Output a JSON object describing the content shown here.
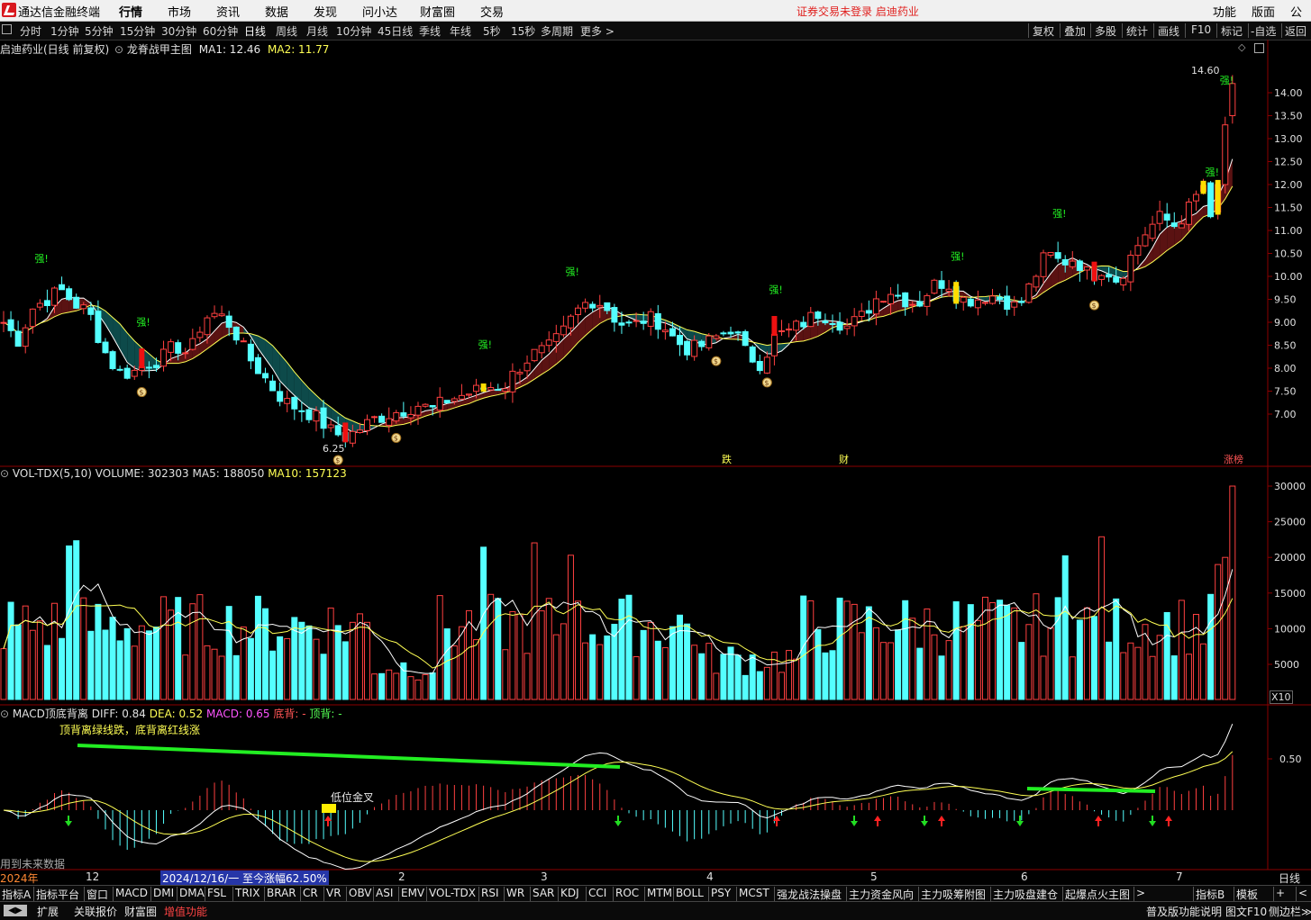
{
  "app": {
    "title": "通达信金融终端",
    "menus": [
      "行情",
      "市场",
      "资讯",
      "数据",
      "发现",
      "问小达",
      "财富圈",
      "交易"
    ],
    "notice": "证券交易未登录  启迪药业",
    "right_menus": [
      "功能",
      "版面",
      "公式"
    ]
  },
  "toolbar": {
    "periods": [
      "分时",
      "1分钟",
      "5分钟",
      "15分钟",
      "30分钟",
      "60分钟",
      "日线",
      "周线",
      "月线",
      "10分钟",
      "45日线",
      "季线",
      "年线",
      "5秒",
      "15秒",
      "多周期",
      "更多 >"
    ],
    "active": "日线",
    "right_buttons": [
      "复权",
      "叠加",
      "多股",
      "统计",
      "画线",
      "F10",
      "标记",
      "-自选",
      "返回"
    ]
  },
  "main_panel": {
    "stock": "启迪药业(日线 前复权)",
    "indicator": "龙脊战甲主图",
    "ma1": "MA1: 12.46",
    "ma2": "MA2: 11.77",
    "high_label": "14.60",
    "low_label": "6.25",
    "strong_label": "强!",
    "markers": [
      "跌",
      "财",
      "涨榜"
    ],
    "y_ticks": [
      "14.00",
      "13.50",
      "13.00",
      "12.50",
      "12.00",
      "11.50",
      "11.00",
      "10.50",
      "10.00",
      "9.50",
      "9.00",
      "8.50",
      "8.00",
      "7.50",
      "7.00"
    ]
  },
  "volume_panel": {
    "title": "VOL-TDX(5,10)",
    "volume": "VOLUME: 302303",
    "ma5": "MA5: 188050",
    "ma10": "MA10: 157123",
    "y_ticks": [
      "30000",
      "25000",
      "20000",
      "15000",
      "10000",
      "5000"
    ],
    "unit": "X10"
  },
  "macd_panel": {
    "title": "MACD顶底背离",
    "diff": "DIFF: 0.84",
    "dea": "DEA: 0.52",
    "macd": "MACD: 0.65",
    "bottom_div": "底背: -",
    "top_div": "顶背: -",
    "legend_text": "顶背离绿线跌，底背离红线涨",
    "golden_cross": "低位金叉",
    "future_text": "用到未来数据",
    "y_tick": "0.50"
  },
  "date_axis": {
    "labels": [
      "2024年",
      "12",
      "2024/12/16/一  至今涨幅62.50%",
      "2",
      "3",
      "4",
      "5",
      "6",
      "7"
    ],
    "right": "日线"
  },
  "tabs_row1": [
    "指标A",
    "指标平台",
    "窗口",
    "MACD",
    "DMI",
    "DMA",
    "FSL",
    "TRIX",
    "BRAR",
    "CR",
    "VR",
    "OBV",
    "ASI",
    "EMV",
    "VOL-TDX",
    "RSI",
    "WR",
    "SAR",
    "KDJ",
    "CCI",
    "ROC",
    "MTM",
    "BOLL",
    "PSY",
    "MCST",
    "强龙战法操盘",
    "主力资金风向",
    "主力吸筹附图",
    "主力吸盘建仓",
    "起爆点火主图",
    ">",
    "指标B",
    "模板",
    "+",
    "<"
  ],
  "tabs_row2": [
    "扩展",
    "关联报价",
    "财富圈",
    "增值功能"
  ],
  "tabs_row2_right": [
    "普及版功能说明",
    "图文F10",
    "侧边栏≫"
  ],
  "colors": {
    "up": "#ff4040",
    "down": "#54ffff",
    "ma": "#ffff54",
    "strong": "#22ee22"
  },
  "chart_data": {
    "type": "candlestick",
    "title": "启迪药业(日线 前复权)",
    "ylim": [
      6.25,
      14.6
    ],
    "series": [
      {
        "name": "MA1",
        "last": 12.46
      },
      {
        "name": "MA2",
        "last": 11.77
      }
    ],
    "close_path": [
      9.0,
      8.6,
      9.3,
      9.5,
      9.7,
      9.4,
      9.2,
      8.4,
      7.9,
      7.9,
      8.1,
      8.2,
      8.5,
      8.3,
      9.1,
      9.2,
      8.9,
      8.3,
      7.9,
      7.5,
      7.2,
      7.1,
      6.9,
      6.6,
      6.5,
      6.7,
      6.9,
      7.0,
      7.1,
      7.2,
      7.1,
      7.3,
      7.4,
      7.5,
      7.6,
      7.6,
      8.0,
      8.3,
      8.4,
      8.7,
      9.2,
      9.5,
      9.4,
      9.0,
      8.9,
      9.1,
      9.0,
      8.6,
      8.4,
      8.5,
      8.7,
      8.9,
      8.3,
      8.1,
      8.7,
      8.8,
      9.0,
      9.2,
      9.1,
      8.9,
      9.1,
      9.5,
      9.7,
      9.5,
      9.4,
      9.8,
      9.9,
      9.5,
      9.5,
      9.6,
      9.5,
      9.3,
      9.9,
      10.5,
      10.3,
      10.4,
      10.0,
      10.2,
      9.9,
      10.5,
      11.0,
      11.3,
      11.1,
      11.5,
      12.0,
      13.3,
      14.6
    ],
    "volume_max": 30000,
    "macd": {
      "diff": 0.84,
      "dea": 0.52,
      "macd": 0.65
    }
  }
}
